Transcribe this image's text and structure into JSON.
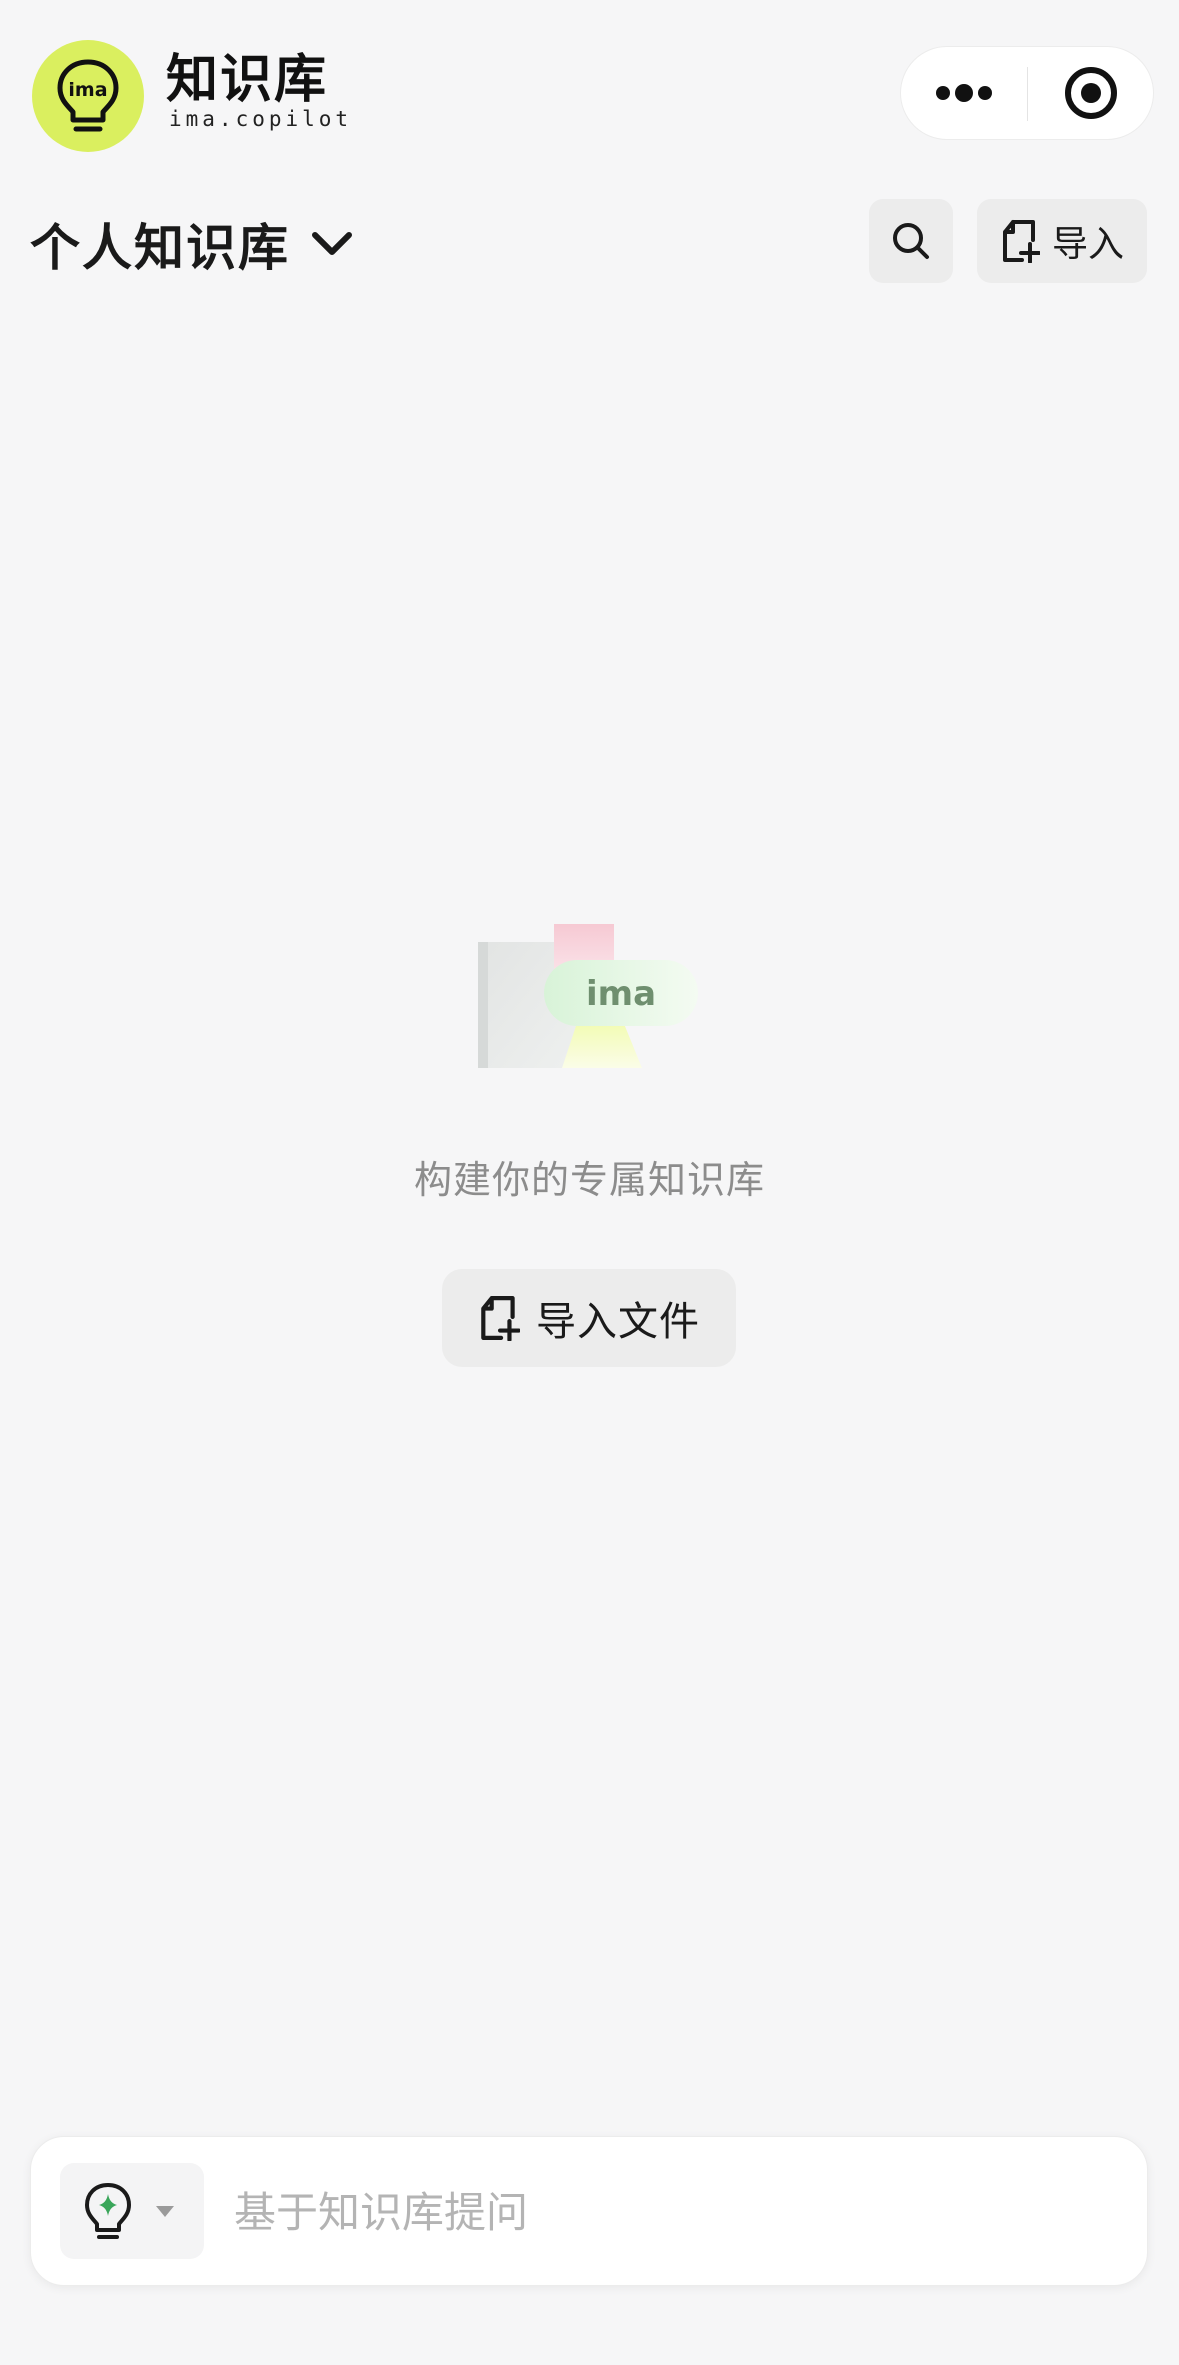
{
  "header": {
    "title": "知识库",
    "subtitle": "ima.copilot",
    "logo_text": "ima",
    "more_icon": "more-dots-icon",
    "close_icon": "target-circle-icon"
  },
  "toolbar": {
    "kb_name": "个人知识库",
    "kb_dropdown_icon": "chevron-down-icon",
    "search_icon": "search-icon",
    "import_label": "导入",
    "import_icon": "file-add-icon"
  },
  "empty_state": {
    "illustration_text": "ima",
    "message": "构建你的专属知识库",
    "button_label": "导入文件",
    "button_icon": "file-add-icon"
  },
  "ask_bar": {
    "placeholder": "基于知识库提问",
    "value": "",
    "model_icon": "lightbulb-sparkle-icon",
    "caret_icon": "caret-down-icon"
  },
  "colors": {
    "brand": "#daef5f",
    "background": "#f6f6f7",
    "button_bg": "#ececec",
    "text": "#1a1a1a",
    "muted_text": "#8c8c8c",
    "placeholder": "#b4b4b4",
    "sparkle_green": "#3aa65a"
  }
}
